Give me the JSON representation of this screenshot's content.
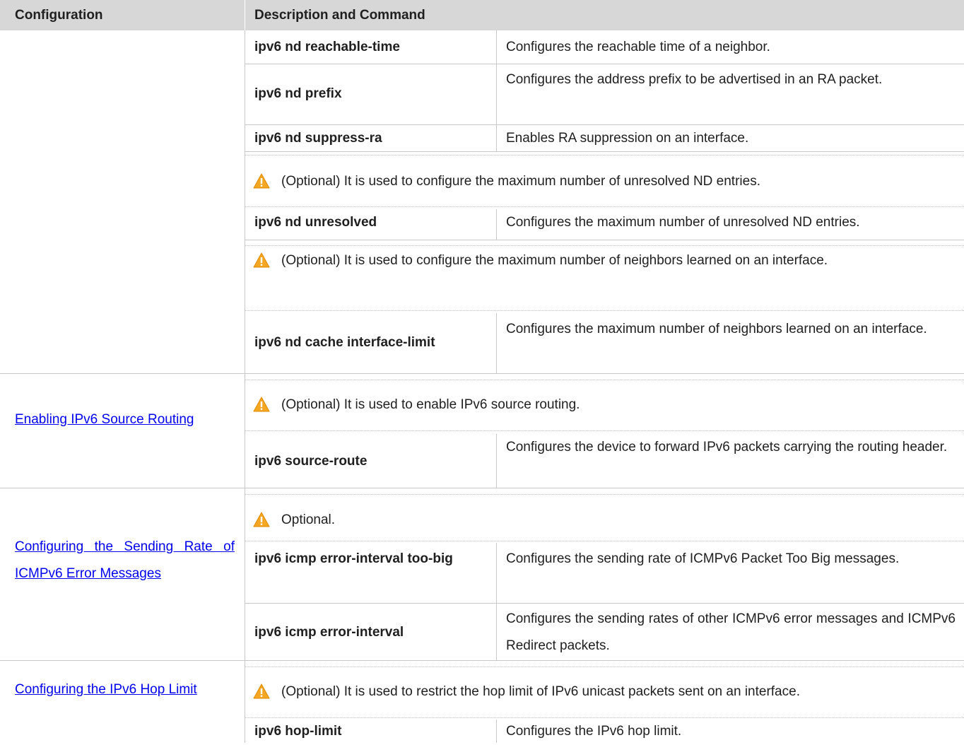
{
  "header": {
    "col1": "Configuration",
    "col2": "Description and Command"
  },
  "rows": {
    "reachable_time": {
      "cmd": "ipv6 nd reachable-time",
      "desc": "Configures the reachable time of a neighbor."
    },
    "prefix": {
      "cmd": "ipv6 nd prefix",
      "desc": "Configures the address prefix to be advertised in an RA packet."
    },
    "suppress_ra": {
      "cmd": "ipv6 nd suppress-ra",
      "desc": "Enables RA suppression on an interface."
    },
    "note_unresolved": "(Optional) It is used to configure the maximum number of unresolved ND entries.",
    "unresolved": {
      "cmd": "ipv6 nd unresolved",
      "desc": "Configures the maximum number of unresolved ND entries."
    },
    "note_cache": "(Optional) It is used to configure the maximum number of neighbors learned on an interface.",
    "cache": {
      "cmd": "ipv6 nd cache interface-limit",
      "desc": "Configures the maximum number of neighbors learned on an interface."
    }
  },
  "sections": {
    "source_routing": {
      "link": "Enabling IPv6 Source Routing",
      "note": "(Optional) It is used to enable IPv6 source routing.",
      "cmd": "ipv6 source-route",
      "desc": "Configures the device to forward IPv6 packets carrying the routing header."
    },
    "icmp_rate": {
      "link": "Configuring the Sending Rate of ICMPv6 Error Messages",
      "note": "Optional.",
      "cmd1": "ipv6 icmp error-interval too-big",
      "desc1": "Configures the sending rate of ICMPv6 Packet Too Big messages.",
      "cmd2": "ipv6 icmp error-interval",
      "desc2": "Configures the sending rates of other ICMPv6 error messages and ICMPv6 Redirect packets."
    },
    "hop_limit": {
      "link": "Configuring the IPv6 Hop Limit",
      "note": "(Optional) It is used to restrict the hop limit of IPv6 unicast packets sent on an interface.",
      "cmd": "ipv6 hop-limit",
      "desc": "Configures the IPv6 hop limit."
    }
  },
  "colors": {
    "header_bg": "#d7d7d7",
    "link": "#0000ee",
    "warning": "#f5a623"
  },
  "icons": {
    "warning": "warning-icon"
  }
}
